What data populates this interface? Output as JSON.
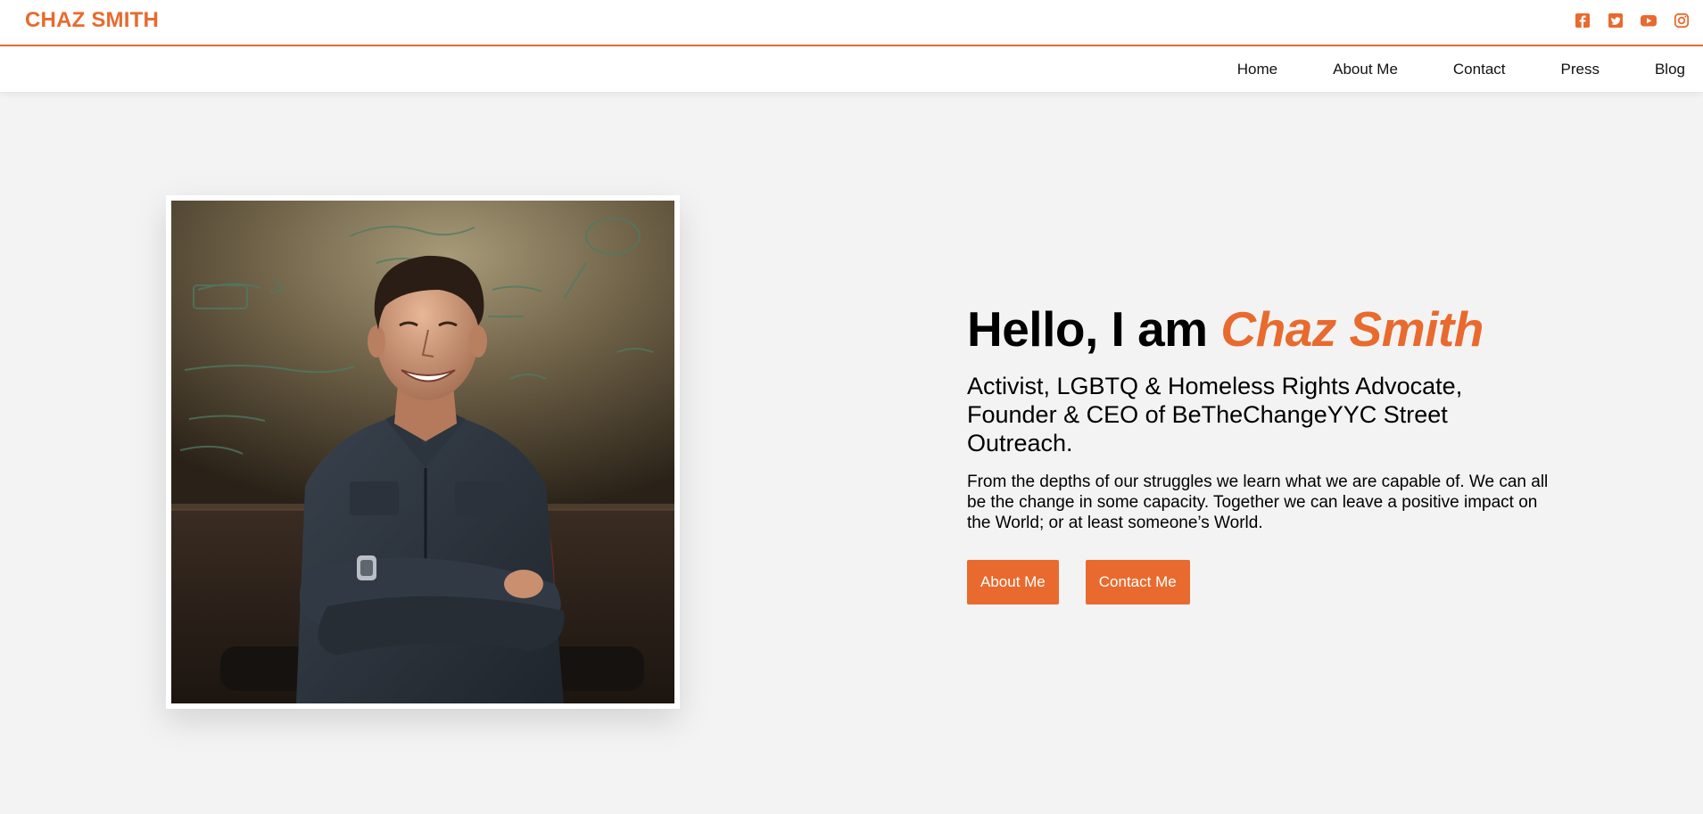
{
  "brand": {
    "name": "CHAZ SMITH",
    "accent_color": "#e86a2e"
  },
  "socials": [
    {
      "icon": "facebook-icon"
    },
    {
      "icon": "twitter-icon"
    },
    {
      "icon": "youtube-icon"
    },
    {
      "icon": "instagram-icon"
    }
  ],
  "nav": {
    "items": [
      {
        "label": "Home"
      },
      {
        "label": "About Me"
      },
      {
        "label": "Contact"
      },
      {
        "label": "Press"
      },
      {
        "label": "Blog"
      }
    ]
  },
  "hero": {
    "greeting": "Hello, I am",
    "name": "Chaz Smith",
    "subtitle": "Activist, LGBTQ & Homeless Rights Advocate, Founder & CEO of BeTheChangeYYC Street Outreach.",
    "body": "From the depths of our struggles we learn what we are capable of. We can all be the change in some capacity. Together we can leave a positive impact on the World; or at least someone’s World.",
    "buttons": {
      "about": "About Me",
      "contact": "Contact Me"
    }
  }
}
